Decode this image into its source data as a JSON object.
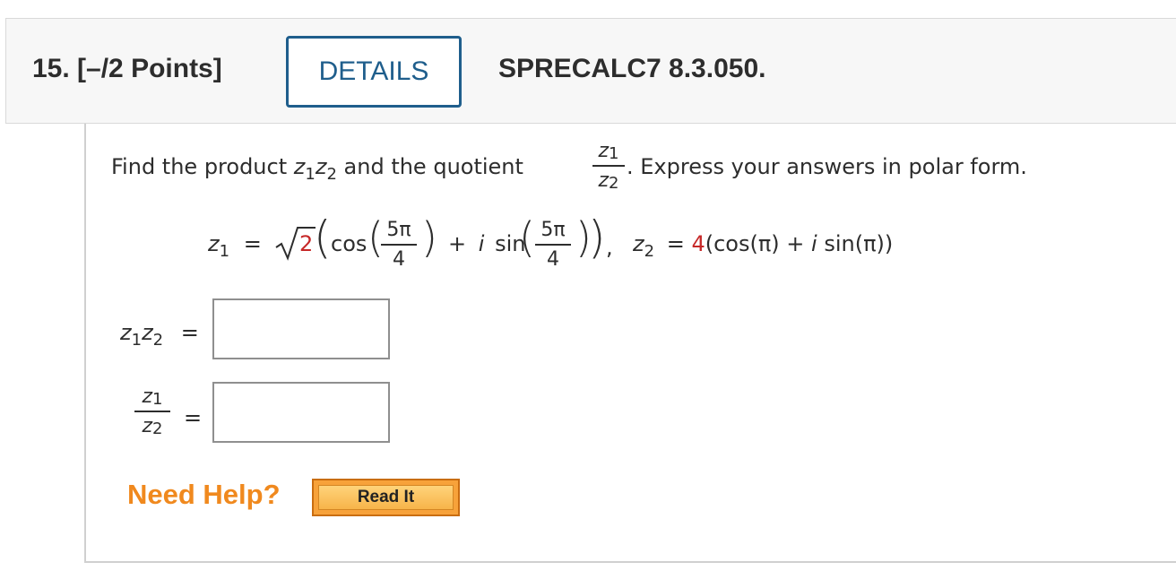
{
  "header": {
    "question_number": "15. [–/2 Points]",
    "details_label": "DETAILS",
    "question_code": "SPRECALC7 8.3.050."
  },
  "prompt": {
    "part1": "Find the product ",
    "part2": " and the quotient ",
    "part3": ". Express your answers in polar form."
  },
  "math": {
    "z": "z",
    "sub1": "1",
    "sub2": "2",
    "equals": "=",
    "sqrt_value": "2",
    "cos": "cos",
    "sin": "sin",
    "plus": "+",
    "i": "i",
    "five_pi": "5π",
    "four": "4",
    "comma": ",",
    "z2_coeff": "4",
    "z2_expr": "(cos(π) + ",
    "z2_expr2": "sin(π))"
  },
  "answers": {
    "product_value": "",
    "quotient_value": ""
  },
  "help": {
    "need_help": "Need Help?",
    "read_it": "Read It"
  },
  "colors": {
    "accent_blue": "#1f5e8c",
    "red_value": "#c62828",
    "help_orange": "#f0891e"
  }
}
